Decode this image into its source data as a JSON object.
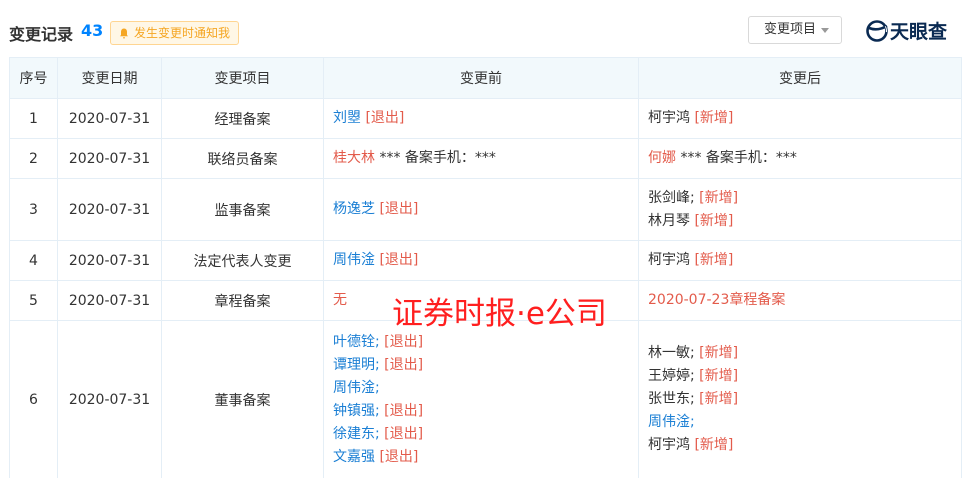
{
  "header": {
    "title": "变更记录",
    "count": "43",
    "notify_label": "发生变更时通知我",
    "filter_label": "变更项目",
    "logo_text": "天眼查"
  },
  "colors": {
    "accent_blue": "#0084ff",
    "link_blue": "#1b7fd4",
    "tag_red": "#e35b4b",
    "notify_orange": "#f5a623",
    "header_bg": "#f2f9fc"
  },
  "table": {
    "columns": [
      "序号",
      "变更日期",
      "变更项目",
      "变更前",
      "变更后"
    ],
    "rows": [
      {
        "no": "1",
        "date": "2020-07-31",
        "item": "经理备案",
        "before": [
          {
            "name": "刘曌",
            "tag": "[退出]"
          }
        ],
        "after": [
          {
            "name": "柯宇鸿",
            "tag": "[新增]"
          }
        ]
      },
      {
        "no": "2",
        "date": "2020-07-31",
        "item": "联络员备案",
        "before": [
          {
            "name": "桂大林",
            "rest": " *** 备案手机：***"
          }
        ],
        "after": [
          {
            "name": "何娜",
            "rest": " *** 备案手机：***"
          }
        ]
      },
      {
        "no": "3",
        "date": "2020-07-31",
        "item": "监事备案",
        "before": [
          {
            "name": "杨逸芝",
            "tag": "[退出]"
          }
        ],
        "after": [
          {
            "name": "张剑峰;",
            "tag": "[新增]"
          },
          {
            "name": "林月琴",
            "tag": "[新增]"
          }
        ]
      },
      {
        "no": "4",
        "date": "2020-07-31",
        "item": "法定代表人变更",
        "before": [
          {
            "name": "周伟淦",
            "tag": "[退出]"
          }
        ],
        "after": [
          {
            "name": "柯宇鸿",
            "tag": "[新增]"
          }
        ]
      },
      {
        "no": "5",
        "date": "2020-07-31",
        "item": "章程备案",
        "before": [
          {
            "name": "无"
          }
        ],
        "after": [
          {
            "name": "2020-07-23章程备案"
          }
        ]
      },
      {
        "no": "6",
        "date": "2020-07-31",
        "item": "董事备案",
        "before": [
          {
            "name": "叶德铨;",
            "tag": "[退出]"
          },
          {
            "name": "谭理明;",
            "tag": "[退出]"
          },
          {
            "name": "周伟淦;"
          },
          {
            "name": "钟镇强;",
            "tag": "[退出]"
          },
          {
            "name": "徐建东;",
            "tag": "[退出]"
          },
          {
            "name": "文嘉强",
            "tag": "[退出]"
          }
        ],
        "after": [
          {
            "name": "林一敏;",
            "tag": "[新增]"
          },
          {
            "name": "王婷婷;",
            "tag": "[新增]"
          },
          {
            "name": "张世东;",
            "tag": "[新增]"
          },
          {
            "name": "周伟淦;"
          },
          {
            "name": "柯宇鸿",
            "tag": "[新增]"
          }
        ]
      }
    ]
  },
  "watermark": "证券时报·e公司"
}
